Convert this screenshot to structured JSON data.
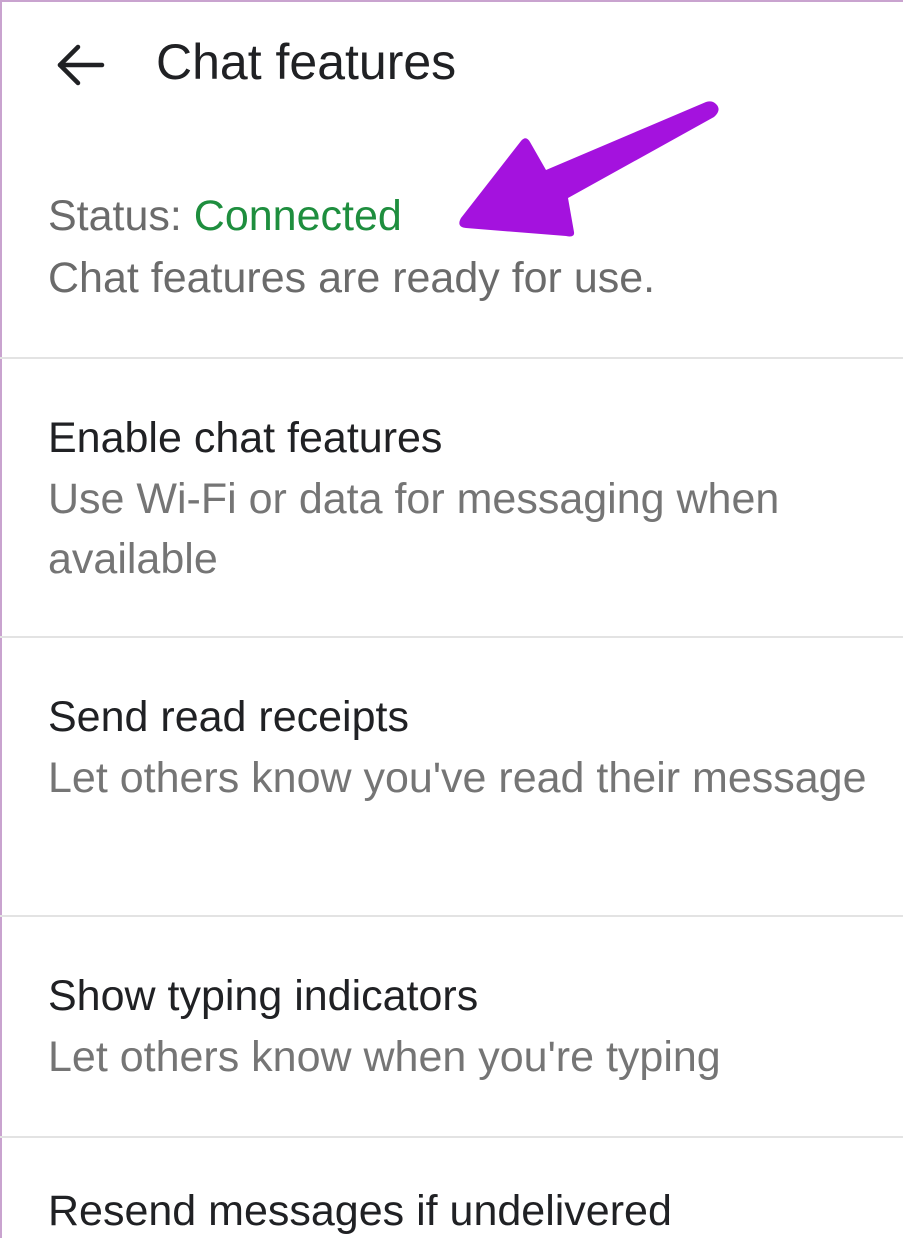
{
  "header": {
    "back_icon": "arrow-left-icon",
    "title": "Chat features"
  },
  "status": {
    "label": "Status: ",
    "value": "Connected",
    "value_color": "#1e8e3e",
    "description": "Chat features are ready for use."
  },
  "annotation": {
    "icon": "pointer-arrow-icon",
    "color": "#a010d8"
  },
  "settings": [
    {
      "title": "Enable chat features",
      "description": "Use Wi-Fi or data for messaging when available"
    },
    {
      "title": "Send read receipts",
      "description": "Let others know you've read their message"
    },
    {
      "title": "Show typing indicators",
      "description": "Let others know when you're typing"
    },
    {
      "title": "Resend messages if undelivered",
      "description": ""
    }
  ]
}
